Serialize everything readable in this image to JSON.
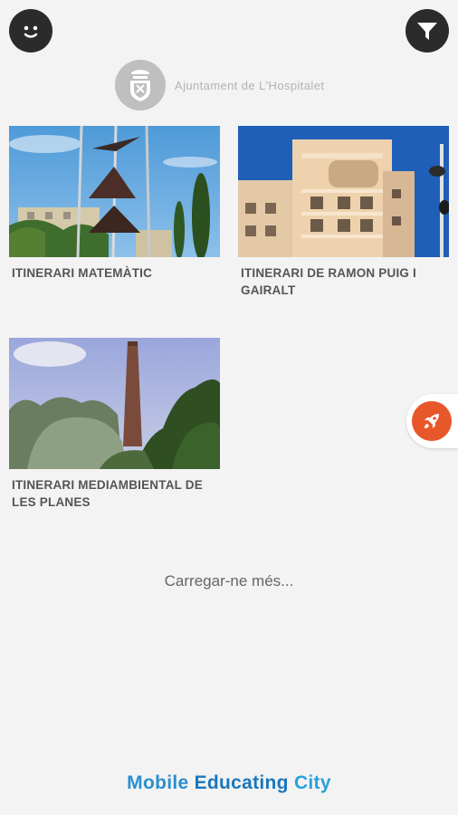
{
  "header": {
    "org_name": "Ajuntament de L'Hospitalet",
    "menu_icon": "smiley-face-icon",
    "filter_icon": "funnel-filter-icon"
  },
  "cards": [
    {
      "title": "ITINERARI MATEMÀTIC",
      "image": "sky-triangles-sculpture-photo"
    },
    {
      "title": "ITINERARI DE RAMON PUIG I GAIRALT",
      "image": "art-deco-building-photo"
    },
    {
      "title": "ITINERARI MEDIAMBIENTAL DE LES PLANES",
      "image": "chimney-trees-photo"
    }
  ],
  "fab": {
    "icon": "rocket-icon",
    "color": "#e8572a"
  },
  "load_more": "Carregar-ne més...",
  "brand": {
    "part1": "Mobile ",
    "part2": "Educating ",
    "part3": "City"
  },
  "colors": {
    "background": "#f3f3f3",
    "accent": "#e8572a",
    "brand": "#2a8fd0"
  }
}
